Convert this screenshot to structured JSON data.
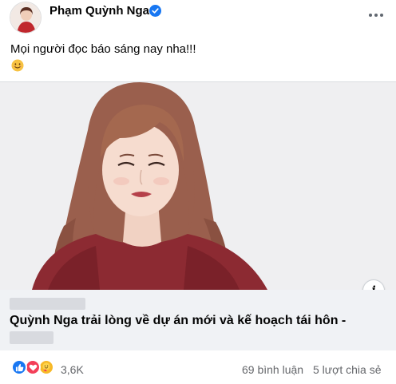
{
  "post": {
    "author": "Phạm Quỳnh Nga",
    "text": "Mọi người đọc báo sáng nay nha!!!",
    "emoji": "smiling-face"
  },
  "link_preview": {
    "title": "Quỳnh Nga trải lòng về dự án mới và kế hoạch tái hôn -",
    "info_label": "i"
  },
  "engagement": {
    "reaction_count": "3,6K",
    "comments": "69 bình luận",
    "shares": "5 lượt chia sẻ",
    "reactions": [
      "like",
      "love",
      "care"
    ]
  },
  "colors": {
    "like": "#1877f2",
    "love": "#f33e58",
    "care": "#f7b928",
    "verified": "#1877f2"
  }
}
